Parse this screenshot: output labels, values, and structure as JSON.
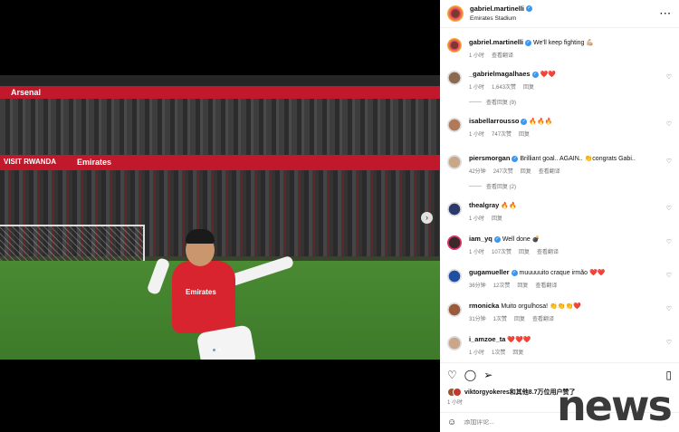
{
  "photo": {
    "ad_arsenal": "Arsenal",
    "ad_emirates": "Emirates",
    "ad_rwanda": "VISIT RWANDA",
    "shirt_text": "Emirates"
  },
  "header": {
    "username": "gabriel.martinelli",
    "location": "Emirates Stadium",
    "more": "···"
  },
  "caption": {
    "username": "gabriel.martinelli",
    "text": "We'll keep fighting 💪🏼",
    "time": "1 小时",
    "translate": "查看翻译"
  },
  "comments": [
    {
      "username": "_gabrielmagalhaes",
      "verified": true,
      "text": "❤️❤️",
      "time": "1 小时",
      "likes": "1,643次赞",
      "reply": "回复",
      "replies": "查看回复 (9)"
    },
    {
      "username": "isabellarrousso",
      "verified": true,
      "text": "🔥🔥🔥",
      "time": "1 小时",
      "likes": "747次赞",
      "reply": "回复"
    },
    {
      "username": "piersmorgan",
      "verified": true,
      "text": "Brilliant goal.. AGAIN.. 👏congrats Gabi..",
      "time": "42分钟",
      "likes": "247次赞",
      "reply": "回复",
      "translate": "查看翻译",
      "replies": "查看回复 (2)"
    },
    {
      "username": "thealgray",
      "verified": false,
      "text": "🔥🔥",
      "time": "1 小时",
      "reply": "回复"
    },
    {
      "username": "iam_yq",
      "verified": true,
      "text": "Well done 💣",
      "time": "1 小时",
      "likes": "107次赞",
      "reply": "回复",
      "translate": "查看翻译"
    },
    {
      "username": "gugamueller",
      "verified": true,
      "text": "muuuuuito craque irmão ❤️❤️",
      "time": "36分钟",
      "likes": "12次赞",
      "reply": "回复",
      "translate": "查看翻译"
    },
    {
      "username": "rmonicka",
      "verified": false,
      "text": "Muito orgulhosa! 👏👏👏❤️",
      "time": "31分钟",
      "likes": "1次赞",
      "reply": "回复",
      "translate": "查看翻译"
    },
    {
      "username": "i_amzoe_ta",
      "verified": false,
      "text": "❤️❤️❤️",
      "time": "1 小时",
      "likes": "1次赞",
      "reply": "回复"
    }
  ],
  "footer": {
    "likes_text": "viktorgyokeres和其他8.7万位用户赞了",
    "age": "1 小时",
    "comment_placeholder": "添加评论..."
  },
  "watermark": "news"
}
